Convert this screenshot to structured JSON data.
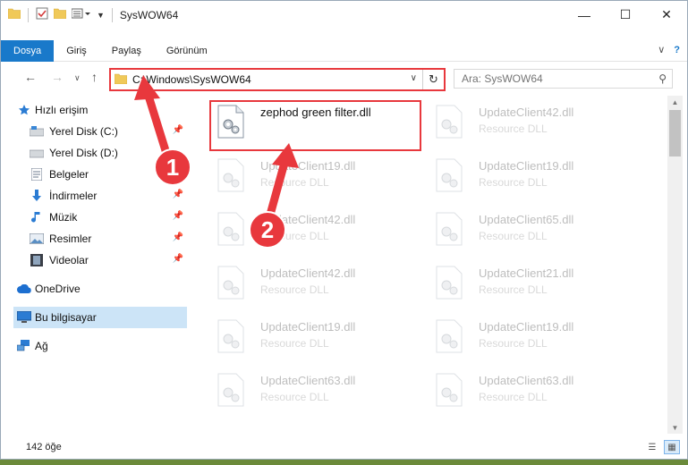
{
  "window": {
    "title": "SysWOW64"
  },
  "ribbon": {
    "tabs": [
      {
        "label": "Dosya",
        "active": true
      },
      {
        "label": "Giriş",
        "active": false
      },
      {
        "label": "Paylaş",
        "active": false
      },
      {
        "label": "Görünüm",
        "active": false
      }
    ]
  },
  "address": {
    "path": "C:\\Windows\\SysWOW64"
  },
  "search": {
    "placeholder": "Ara: SysWOW64"
  },
  "sidebar": {
    "items": [
      {
        "label": "Hızlı erişim",
        "icon": "star-icon",
        "pinned": false
      },
      {
        "label": "Yerel Disk (C:)",
        "icon": "drive-icon",
        "pinned": true
      },
      {
        "label": "Yerel Disk (D:)",
        "icon": "drive-icon",
        "pinned": false
      },
      {
        "label": "Belgeler",
        "icon": "documents-icon",
        "pinned": true
      },
      {
        "label": "İndirmeler",
        "icon": "download-icon",
        "pinned": true
      },
      {
        "label": "Müzik",
        "icon": "music-icon",
        "pinned": true
      },
      {
        "label": "Resimler",
        "icon": "pictures-icon",
        "pinned": true
      },
      {
        "label": "Videolar",
        "icon": "videos-icon",
        "pinned": true
      },
      {
        "label": "OneDrive",
        "icon": "cloud-icon",
        "pinned": false
      },
      {
        "label": "Bu bilgisayar",
        "icon": "computer-icon",
        "pinned": false,
        "selected": true
      },
      {
        "label": "Ağ",
        "icon": "network-icon",
        "pinned": false
      }
    ]
  },
  "files": {
    "highlighted": {
      "name": "zephod green filter.dll"
    },
    "col1": [
      {
        "name": "UpdateClient19.dll",
        "type": "Resource DLL"
      },
      {
        "name": "UpdateClient42.dll",
        "type": "Resource DLL"
      },
      {
        "name": "UpdateClient42.dll",
        "type": "Resource DLL"
      },
      {
        "name": "UpdateClient19.dll",
        "type": "Resource DLL"
      },
      {
        "name": "UpdateClient63.dll",
        "type": "Resource DLL"
      }
    ],
    "col2": [
      {
        "name": "UpdateClient42.dll",
        "type": "Resource DLL"
      },
      {
        "name": "UpdateClient19.dll",
        "type": "Resource DLL"
      },
      {
        "name": "UpdateClient65.dll",
        "type": "Resource DLL"
      },
      {
        "name": "UpdateClient21.dll",
        "type": "Resource DLL"
      },
      {
        "name": "UpdateClient19.dll",
        "type": "Resource DLL"
      },
      {
        "name": "UpdateClient63.dll",
        "type": "Resource DLL"
      }
    ]
  },
  "status": {
    "count": "142 öğe"
  },
  "annotations": {
    "step1": "1",
    "step2": "2",
    "color": "#e8383d"
  },
  "colors": {
    "accent": "#1979ca",
    "selected": "#cce4f7"
  }
}
